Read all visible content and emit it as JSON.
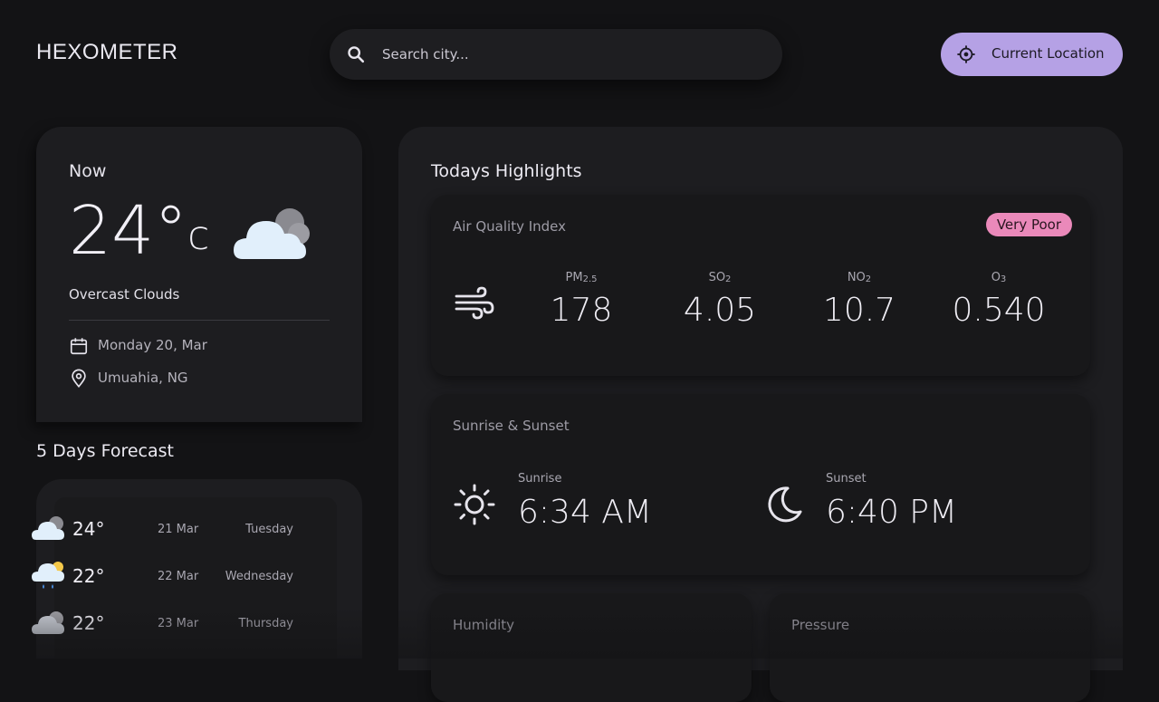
{
  "header": {
    "logo": "HEXOMETER",
    "search_placeholder": "Search city...",
    "search_value": "",
    "location_button": "Current Location"
  },
  "now": {
    "title": "Now",
    "temperature": "24°",
    "unit": "c",
    "condition": "Overcast Clouds",
    "date": "Monday 20, Mar",
    "location": "Umuahia, NG",
    "icon": "overcast-cloud-icon"
  },
  "forecast": {
    "title": "5 Days Forecast",
    "items": [
      {
        "temp": "24°",
        "date": "21 Mar",
        "day": "Tuesday",
        "icon": "cloudy-icon"
      },
      {
        "temp": "22°",
        "date": "22 Mar",
        "day": "Wednesday",
        "icon": "rain-sun-icon"
      },
      {
        "temp": "22°",
        "date": "23 Mar",
        "day": "Thursday",
        "icon": "overcast-icon"
      }
    ]
  },
  "highlights": {
    "title": "Todays Highlights",
    "air_quality": {
      "title": "Air Quality Index",
      "badge": "Very Poor",
      "badge_color": "#ea89ba",
      "pm25_label": "PM",
      "pm25_sub": "2.5",
      "pm25": "178",
      "so2_label": "SO",
      "so2_sub": "2",
      "so2": "4.05",
      "no2_label": "NO",
      "no2_sub": "2",
      "no2": "10.7",
      "o3_label": "O",
      "o3_sub": "3",
      "o3": "0.540"
    },
    "sun": {
      "title": "Sunrise & Sunset",
      "sunrise_label": "Sunrise",
      "sunrise": "6:34 AM",
      "sunset_label": "Sunset",
      "sunset": "6:40 PM"
    },
    "humidity_title": "Humidity",
    "pressure_title": "Pressure"
  },
  "colors": {
    "background": "#131315",
    "card": "#1d1d20",
    "accent": "#b5a1e5"
  }
}
